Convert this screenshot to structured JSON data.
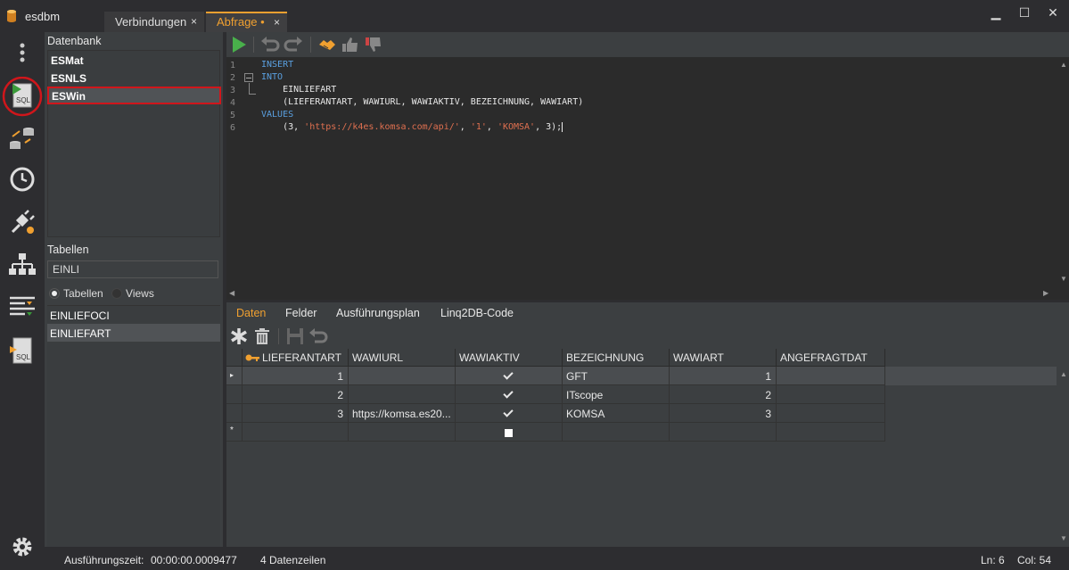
{
  "app": {
    "title": "esdbm",
    "accent": "#f0a030",
    "highlight": "#d0161b"
  },
  "tabs": [
    {
      "label": "Verbindungen",
      "close": "×"
    },
    {
      "label": "Abfrage •",
      "close": "×"
    }
  ],
  "window_controls": {
    "minimize": "▁",
    "maximize": "☐",
    "close": "✕"
  },
  "iconbar": [
    "more-vertical-icon",
    "sql-query-icon",
    "database-transfer-icon",
    "history-clock-icon",
    "plug-settings-icon",
    "hierarchy-icon",
    "list-filter-icon",
    "sql-file-icon",
    "gear-icon"
  ],
  "left_panel": {
    "databases_header": "Datenbank",
    "databases": [
      {
        "label": "ESMat",
        "selected": false
      },
      {
        "label": "ESNLS",
        "selected": false
      },
      {
        "label": "ESWin",
        "selected": true
      }
    ],
    "tables_header": "Tabellen",
    "filter_value": "EINLI",
    "radio_tables": "Tabellen",
    "radio_views": "Views",
    "tables": [
      {
        "label": "EINLIEFOCI",
        "selected": false
      },
      {
        "label": "EINLIEFART",
        "selected": true
      }
    ]
  },
  "editor": {
    "toolbar_icons": [
      "run-icon",
      "undo-icon",
      "redo-icon",
      "handshake-icon",
      "thumbs-up-icon",
      "thumbs-down-icon"
    ],
    "line_numbers": [
      "1",
      "2",
      "3",
      "4",
      "5",
      "6"
    ],
    "lines": {
      "l1_kw": "INSERT",
      "l2_kw": "INTO",
      "l3_text": "    EINLIEFART",
      "l4_text": "    (LIEFERANTART, WAWIURL, WAWIAKTIV, BEZEICHNUNG, WAWIART)",
      "l5_kw": "VALUES",
      "l6_pre": "    (3, ",
      "l6_str1": "'https://k4es.komsa.com/api/'",
      "l6_mid1": ", ",
      "l6_str2": "'1'",
      "l6_mid2": ", ",
      "l6_str3": "'KOMSA'",
      "l6_post": ", 3);"
    }
  },
  "results": {
    "tabs": [
      "Daten",
      "Felder",
      "Ausführungsplan",
      "Linq2DB-Code"
    ],
    "toolbar_icons": [
      "asterisk-new-icon",
      "trash-icon",
      "save-icon",
      "undo-icon"
    ],
    "columns": [
      "LIEFERANTART",
      "WAWIURL",
      "WAWIAKTIV",
      "BEZEICHNUNG",
      "WAWIART",
      "ANGEFRAGTDAT"
    ],
    "rows": [
      {
        "marker": "▸",
        "lieferantart": "1",
        "wawiurl": "",
        "wawiaktiv": true,
        "bezeichnung": "GFT",
        "wawiart": "1",
        "angefragtdat": ""
      },
      {
        "marker": "",
        "lieferantart": "2",
        "wawiurl": "",
        "wawiaktiv": true,
        "bezeichnung": "ITscope",
        "wawiart": "2",
        "angefragtdat": ""
      },
      {
        "marker": "",
        "lieferantart": "3",
        "wawiurl": "https://komsa.es20...",
        "wawiaktiv": true,
        "bezeichnung": "KOMSA",
        "wawiart": "3",
        "angefragtdat": ""
      }
    ],
    "new_row_marker": "*"
  },
  "status": {
    "exec_label": "Ausführungszeit:",
    "exec_value": "00:00:00.0009477",
    "rows_label": "4 Datenzeilen",
    "ln": "Ln:  6",
    "col": "Col: 54"
  }
}
